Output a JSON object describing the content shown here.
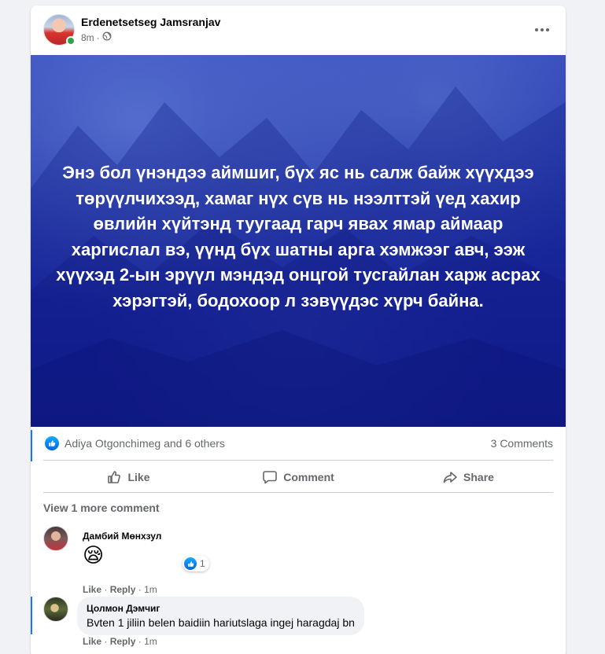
{
  "post": {
    "author": "Erdenetsetseg Jamsranjav",
    "time": "8m",
    "visibility_sep": "·",
    "text": "Энэ бол үнэндээ аймшиг, бүх яс нь салж байж хүүхдээ төрүүлчихээд, хамаг нүх сүв нь нээлттэй үед хахир өвлийн хүйтэнд туугаад гарч явах ямар аймаар харгислал вэ, үүнд бүх шатны арга хэмжээг авч, ээж хүүхэд 2-ын эрүүл мэндэд онцгой тусгайлан харж асрах хэрэгтэй, бодохоор л зэвүүдэс хүрч байна.",
    "background_color": "#1a2ba0"
  },
  "reactions": {
    "names": "Adiya Otgonchimeg and 6 others",
    "comments_count": "3 Comments"
  },
  "actions": {
    "like": "Like",
    "comment": "Comment",
    "share": "Share"
  },
  "comments": {
    "view_more": "View 1 more comment",
    "items": [
      {
        "name": "Дамбий Мөнхзул",
        "emoji": "😪",
        "reaction_count": "1",
        "like": "Like",
        "reply": "Reply",
        "time": "1m",
        "sep": "·"
      },
      {
        "name": "Цолмон Дэмчиг",
        "text": "Bvten 1 jiliin belen baidiin hariutslaga ingej haragdaj bn",
        "like": "Like",
        "reply": "Reply",
        "time": "1m",
        "sep": "·"
      }
    ]
  },
  "colors": {
    "accent": "#1877f2",
    "online": "#31a24c",
    "muted_text": "#65676b"
  }
}
